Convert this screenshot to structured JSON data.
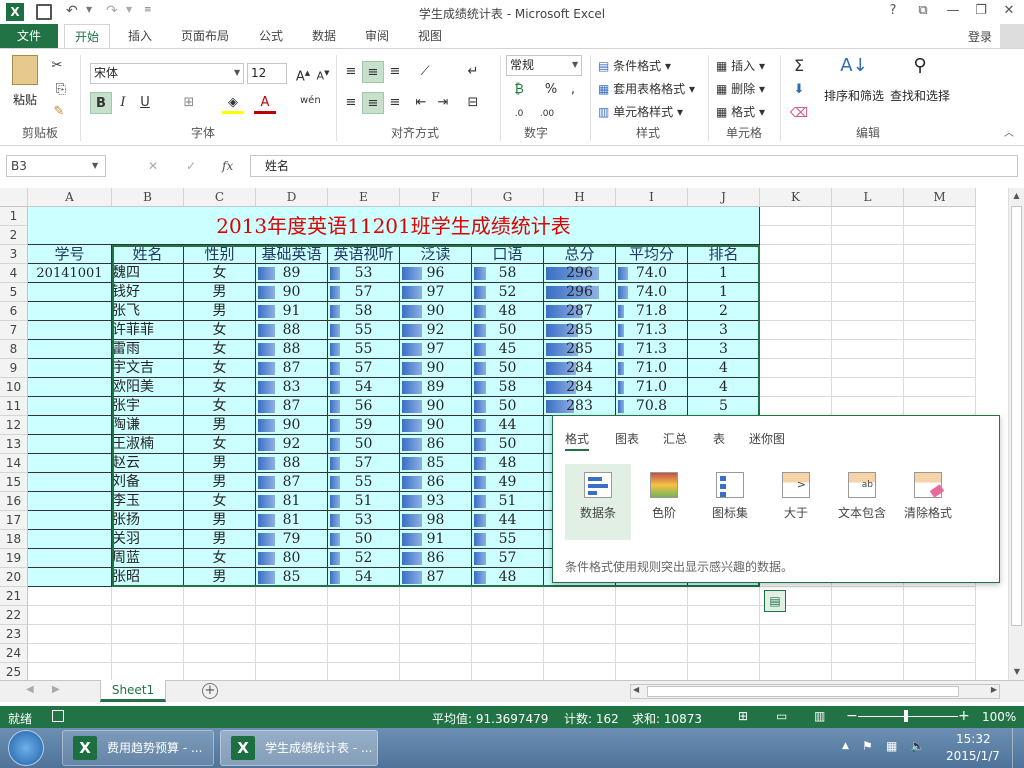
{
  "window": {
    "title": "学生成绩统计表 - Microsoft Excel",
    "help": "?",
    "signin": "登录"
  },
  "tabs": [
    "文件",
    "开始",
    "插入",
    "页面布局",
    "公式",
    "数据",
    "审阅",
    "视图"
  ],
  "ribbon": {
    "clipboard": {
      "paste": "粘贴",
      "label": "剪贴板"
    },
    "font": {
      "name": "宋体",
      "size": "12",
      "bold": "B",
      "italic": "I",
      "underline": "U",
      "label": "字体",
      "phonetic": "wén"
    },
    "alignment": {
      "label": "对齐方式"
    },
    "number": {
      "format": "常规",
      "percent": "%",
      "comma": ",",
      "label": "数字"
    },
    "styles": {
      "conditional": "条件格式",
      "table": "套用表格格式",
      "cell": "单元格样式",
      "label": "样式"
    },
    "cells": {
      "insert": "插入",
      "delete": "删除",
      "format": "格式",
      "label": "单元格"
    },
    "editing": {
      "sort": "排序和筛选",
      "find": "查找和选择",
      "label": "编辑"
    }
  },
  "formula_bar": {
    "cell_ref": "B3",
    "fx": "fx",
    "content": "姓名"
  },
  "columns": [
    "A",
    "B",
    "C",
    "D",
    "E",
    "F",
    "G",
    "H",
    "I",
    "J",
    "K",
    "L",
    "M"
  ],
  "rows": [
    "1",
    "2",
    "3",
    "4",
    "5",
    "6",
    "7",
    "8",
    "9",
    "10",
    "11",
    "12",
    "13",
    "14",
    "15",
    "16",
    "17",
    "18",
    "19",
    "20",
    "21",
    "22",
    "23",
    "24",
    "25"
  ],
  "sheet": {
    "title": "2013年度英语11201班学生成绩统计表",
    "headers": [
      "学号",
      "姓名",
      "性别",
      "基础英语",
      "英语视听",
      "泛读",
      "口语",
      "总分",
      "平均分",
      "排名"
    ],
    "records": [
      [
        "20141001",
        "魏四",
        "女",
        "89",
        "53",
        "96",
        "58",
        "296",
        "74.0",
        "1"
      ],
      [
        "",
        "钱好",
        "男",
        "90",
        "57",
        "97",
        "52",
        "296",
        "74.0",
        "1"
      ],
      [
        "",
        "张飞",
        "男",
        "91",
        "58",
        "90",
        "48",
        "287",
        "71.8",
        "2"
      ],
      [
        "",
        "许菲菲",
        "女",
        "88",
        "55",
        "92",
        "50",
        "285",
        "71.3",
        "3"
      ],
      [
        "",
        "雷雨",
        "女",
        "88",
        "55",
        "97",
        "45",
        "285",
        "71.3",
        "3"
      ],
      [
        "",
        "宇文吉",
        "女",
        "87",
        "57",
        "90",
        "50",
        "284",
        "71.0",
        "4"
      ],
      [
        "",
        "欧阳美",
        "女",
        "83",
        "54",
        "89",
        "58",
        "284",
        "71.0",
        "4"
      ],
      [
        "",
        "张宇",
        "女",
        "87",
        "56",
        "90",
        "50",
        "283",
        "70.8",
        "5"
      ],
      [
        "",
        "陶谦",
        "男",
        "90",
        "59",
        "90",
        "44",
        "",
        "",
        ""
      ],
      [
        "",
        "王淑楠",
        "女",
        "92",
        "50",
        "86",
        "50",
        "",
        "",
        ""
      ],
      [
        "",
        "赵云",
        "男",
        "88",
        "57",
        "85",
        "48",
        "",
        "",
        ""
      ],
      [
        "",
        "刘备",
        "男",
        "87",
        "55",
        "86",
        "49",
        "",
        "",
        ""
      ],
      [
        "",
        "李玉",
        "女",
        "81",
        "51",
        "93",
        "51",
        "",
        "",
        ""
      ],
      [
        "",
        "张扬",
        "男",
        "81",
        "53",
        "98",
        "44",
        "",
        "",
        ""
      ],
      [
        "",
        "关羽",
        "男",
        "79",
        "50",
        "91",
        "55",
        "",
        "",
        ""
      ],
      [
        "",
        "周蓝",
        "女",
        "80",
        "52",
        "86",
        "57",
        "",
        "",
        ""
      ],
      [
        "",
        "张昭",
        "男",
        "85",
        "54",
        "87",
        "48",
        "",
        "",
        ""
      ]
    ]
  },
  "quick_analysis": {
    "tabs": [
      "格式",
      "图表",
      "汇总",
      "表",
      "迷你图"
    ],
    "items": [
      "数据条",
      "色阶",
      "图标集",
      "大于",
      "文本包含",
      "清除格式"
    ],
    "description": "条件格式使用规则突出显示感兴趣的数据。"
  },
  "sheet_tab": "Sheet1",
  "status": {
    "ready": "就绪",
    "average": "平均值: 91.3697479",
    "count": "计数: 162",
    "sum": "求和: 10873",
    "zoom": "100%"
  },
  "taskbar": {
    "task1": "费用趋势预算 - ...",
    "task2": "学生成绩统计表 - ...",
    "time": "15:32",
    "date": "2015/1/7"
  }
}
